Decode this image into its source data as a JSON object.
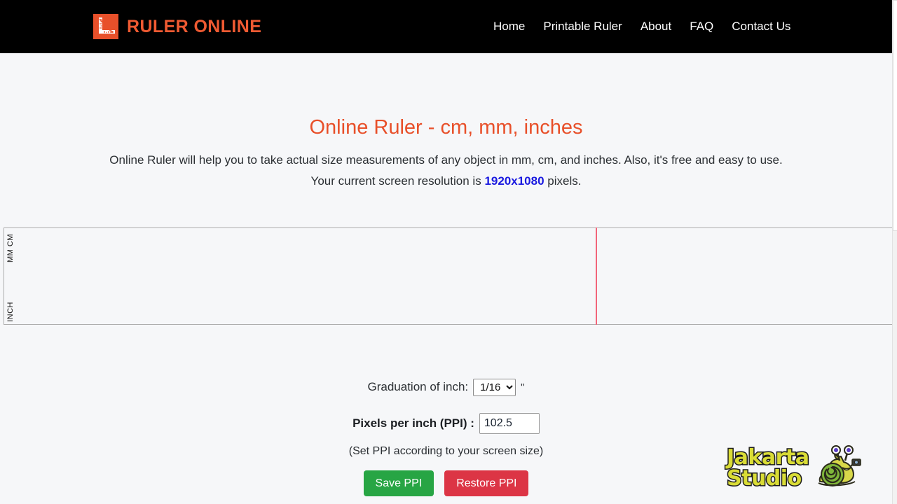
{
  "header": {
    "brand_name": "RULER ONLINE",
    "brand_icon": "ruler-logo-icon",
    "nav": [
      {
        "label": "Home"
      },
      {
        "label": "Printable Ruler"
      },
      {
        "label": "About"
      },
      {
        "label": "FAQ"
      },
      {
        "label": "Contact Us"
      }
    ]
  },
  "hero": {
    "title": "Online Ruler - cm, mm, inches",
    "intro_line1": "Online Ruler will help you to take actual size measurements of any object in mm, cm, and inches. Also, it's free and easy to use.",
    "intro_prefix": "Your current screen resolution is ",
    "resolution": "1920x1080",
    "intro_suffix": " pixels.",
    "title_color": "#e8502a",
    "resolution_color": "#1a1ae0"
  },
  "ruler": {
    "metric_label": "MM CM",
    "inch_label": "INCH",
    "cursor_color": "#f2657a",
    "border_color": "#adadad"
  },
  "controls": {
    "graduation_label": "Graduation of inch:",
    "graduation_value": "1/16",
    "graduation_options": [
      "1/16"
    ],
    "inch_mark": "\"",
    "ppi_label": "Pixels per inch (PPI) :",
    "ppi_value": "102.5",
    "ppi_hint": "(Set PPI according to your screen size)",
    "save_label": "Save PPI",
    "restore_label": "Restore PPI",
    "save_color": "#27a544",
    "restore_color": "#dc3545"
  },
  "watermark": {
    "text": "Jakarta\nStudio",
    "icon": "snail-mascot-icon",
    "text_color": "#d9dc36"
  }
}
